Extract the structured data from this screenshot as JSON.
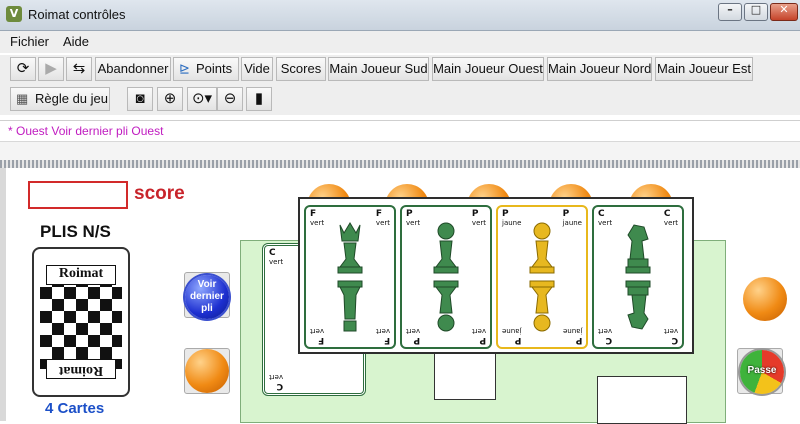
{
  "window": {
    "title": "Roimat contrôles",
    "app_icon": "roimat-app-icon"
  },
  "menu": [
    "Fichier",
    "Aide"
  ],
  "toolbar1": {
    "icons": [
      "refresh-icon",
      "play-icon",
      "swap-arrows-icon"
    ],
    "buttons": [
      "Abandonner",
      "Points",
      "Vide",
      "Scores",
      "Main Joueur Sud",
      "Main Joueur Ouest",
      "Main Joueur Nord",
      "Main Joueur Est"
    ],
    "points_icon": "tree-icon"
  },
  "toolbar2": {
    "rules_label": "Règle du jeu",
    "rules_icon": "table-icon",
    "icons": [
      "camera-icon",
      "zoom-in-icon",
      "zoom-dropdown-icon",
      "zoom-out-icon",
      "card-view-icon"
    ]
  },
  "message": "* Ouest Voir dernier pli Ouest",
  "game": {
    "score_label": "score",
    "plis_label": "PLIS N/S",
    "deck_logo": "Roimat",
    "cards_count": "4 Cartes",
    "voir_button": "Voir dernier pli",
    "passe_button": "Passe"
  },
  "trick_cards": [
    {
      "letter": "F",
      "color_label": "vert",
      "piece": "queen",
      "tint": "green"
    },
    {
      "letter": "P",
      "color_label": "vert",
      "piece": "pawn",
      "tint": "green"
    },
    {
      "letter": "P",
      "color_label": "jaune",
      "piece": "pawn",
      "tint": "yellow"
    },
    {
      "letter": "C",
      "color_label": "vert",
      "piece": "knight",
      "tint": "green"
    }
  ],
  "under_card": {
    "letter": "C",
    "color_label": "vert"
  },
  "colors": {
    "green_piece": "#3f8a4e",
    "yellow_piece": "#e7b820",
    "score_red": "#c8242b",
    "count_blue": "#1c50c8",
    "message_magenta": "#c01cc0",
    "board_green": "#d8f4cf"
  }
}
